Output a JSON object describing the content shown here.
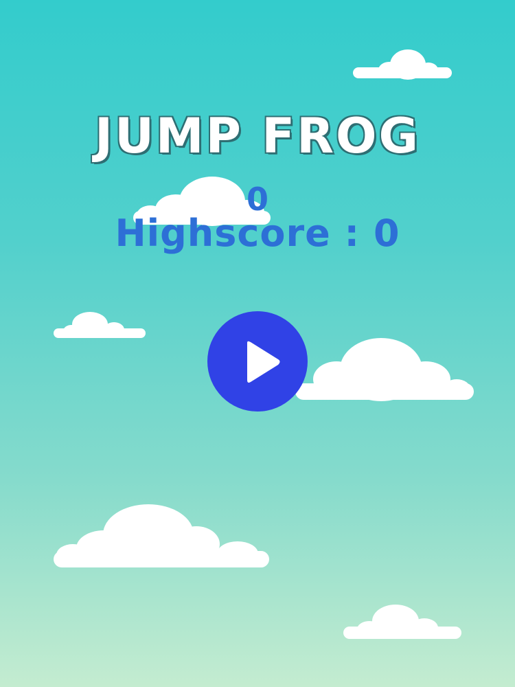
{
  "game": {
    "title": "JUMP FROG",
    "score": "0",
    "highscore_label": "Highscore : 0"
  },
  "icons": {
    "play": "play-icon"
  },
  "colors": {
    "sky_top": "#33cccc",
    "sky_bottom": "#c4ecd0",
    "score_text": "#2d6fd6",
    "play_button": "#3042e6",
    "title_outline": "#2e6e73",
    "cloud": "#ffffff"
  }
}
